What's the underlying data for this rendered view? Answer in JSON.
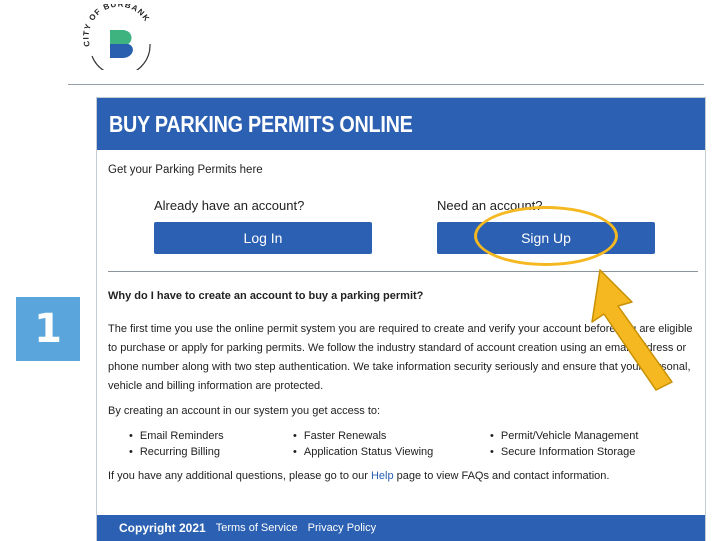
{
  "logo": {
    "city_text": "CITY OF BURBANK",
    "mark": "B"
  },
  "step_badge": "1",
  "panel": {
    "title": "BUY PARKING PERMITS ONLINE",
    "intro": "Get your Parking Permits here",
    "login": {
      "prompt": "Already have an account?",
      "button": "Log In"
    },
    "signup": {
      "prompt": "Need an account?",
      "button": "Sign Up"
    },
    "why_heading": "Why do I have to create an account to buy a parking permit?",
    "why_paragraph": "The first time you use the online permit system you are required to create and verify your account before you are eligible to purchase or apply for parking permits. We follow the industry standard of account creation using an email address or phone number along with two step authentication. We take information security seriously and ensure that your personal, vehicle and billing information are protected.",
    "benefits_intro": "By creating an account in our system you get access to:",
    "benefits": [
      [
        "Email Reminders",
        "Recurring Billing"
      ],
      [
        "Faster Renewals",
        "Application Status Viewing"
      ],
      [
        "Permit/Vehicle Management",
        "Secure Information Storage"
      ]
    ],
    "help": {
      "before": "If you have any additional questions, please go to our ",
      "link": "Help",
      "after": " page to view FAQs and contact information."
    }
  },
  "footer": {
    "copyright": "Copyright 2021",
    "terms": "Terms of Service",
    "privacy": "Privacy Policy"
  },
  "colors": {
    "brand_blue": "#2b60b2",
    "badge_blue": "#5aa6dc",
    "highlight": "#f5b820"
  }
}
